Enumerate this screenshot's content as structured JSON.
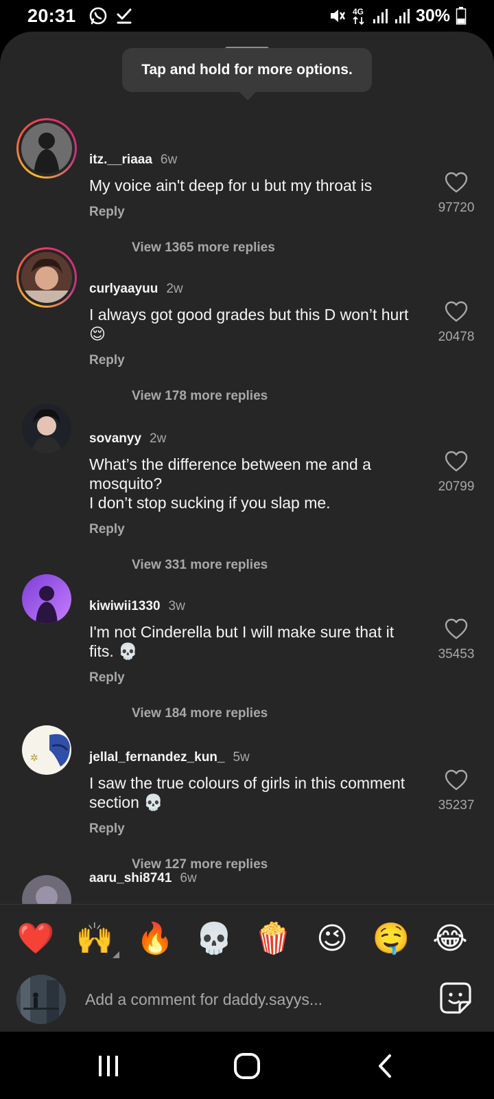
{
  "status_bar": {
    "time": "20:31",
    "left_icons": [
      "whatsapp-icon",
      "checkmark-download-icon"
    ],
    "right_icons": [
      "mute-icon",
      "4g-icon",
      "signal-icon",
      "signal-icon"
    ],
    "battery": "30%"
  },
  "tooltip": {
    "text": "Tap and hold for more options."
  },
  "comments": [
    {
      "user": "itz.__riaaa",
      "time": "6w",
      "text": "My voice ain't  deep for u but my throat is",
      "reply_label": "Reply",
      "likes": "97720",
      "view_replies": "View 1365 more replies"
    },
    {
      "user": "curlyaayuu",
      "time": "2w",
      "text": "I always got good grades but this D won’t hurt😌",
      "reply_label": "Reply",
      "likes": "20478",
      "view_replies": "View 178 more replies"
    },
    {
      "user": "sovanyy",
      "time": "2w",
      "text": "What’s the difference between me and a mosquito?\nI don’t stop sucking if you slap me.",
      "reply_label": "Reply",
      "likes": "20799",
      "view_replies": "View 331 more replies"
    },
    {
      "user": "kiwiwii1330",
      "time": "3w",
      "text": "I'm not Cinderella but I will make sure that it fits. 💀",
      "reply_label": "Reply",
      "likes": "35453",
      "view_replies": "View 184 more replies"
    },
    {
      "user": "jellal_fernandez_kun_",
      "time": "5w",
      "text": "I saw the true colours of girls in this comment section 💀",
      "reply_label": "Reply",
      "likes": "35237",
      "view_replies": "View 127 more replies"
    },
    {
      "user": "aaru_shi8741",
      "time": "6w"
    }
  ],
  "quick_reactions": [
    "❤️",
    "🙌",
    "🔥",
    "💀",
    "🍿",
    "😉",
    "🤤",
    "😂"
  ],
  "composer": {
    "placeholder": "Add a comment for daddy.sayys..."
  },
  "nav_bar": {
    "buttons": [
      "recents-icon",
      "home-icon",
      "back-icon"
    ]
  },
  "colors": {
    "sheet_bg": "#262626",
    "text_primary": "#f5f5f5",
    "text_secondary": "#a8a8a8",
    "like_red": "#ed4956"
  }
}
